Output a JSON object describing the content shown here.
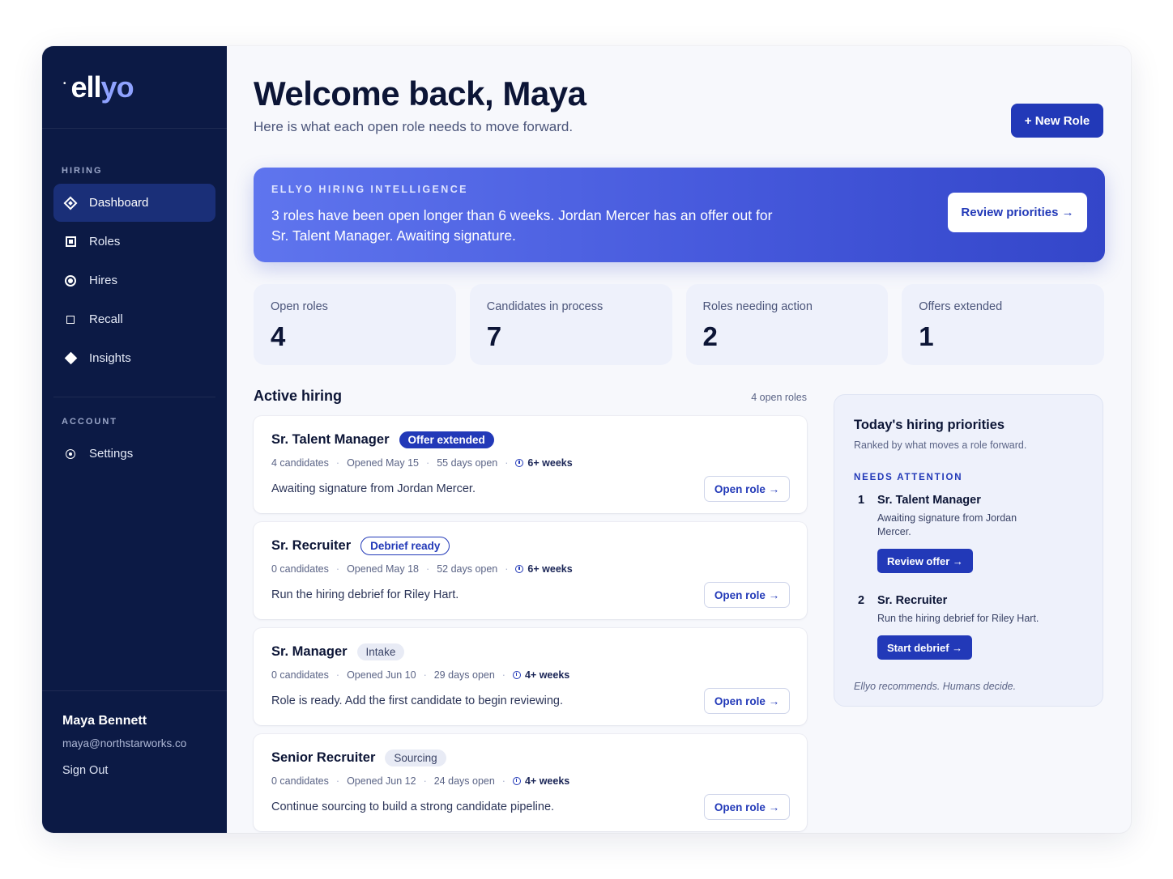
{
  "brand": {
    "name_main": "ell",
    "name_accent": "yo"
  },
  "sidebar": {
    "hiring_title": "HIRING",
    "items": [
      {
        "label": "Dashboard",
        "icon": "diamond-icon",
        "active": true
      },
      {
        "label": "Roles",
        "icon": "square-icon"
      },
      {
        "label": "Hires",
        "icon": "circle-icon"
      },
      {
        "label": "Recall",
        "icon": "square-outline-icon"
      },
      {
        "label": "Insights",
        "icon": "diamond-filled-icon"
      }
    ],
    "account_title": "ACCOUNT",
    "account_items": [
      {
        "label": "Settings",
        "icon": "gear-icon"
      }
    ],
    "user": {
      "name": "Maya Bennett",
      "email": "maya@northstarworks.co",
      "sign_out": "Sign Out"
    }
  },
  "header": {
    "title": "Welcome back, Maya",
    "subtitle": "Here is what each open role needs to move forward.",
    "new_role": "+ New Role"
  },
  "hero": {
    "label": "ELLYO HIRING INTELLIGENCE",
    "text": "3 roles have been open longer than 6 weeks. Jordan Mercer has an offer out for Sr. Talent Manager. Awaiting signature.",
    "button": "Review priorities →"
  },
  "stats": [
    {
      "label": "Open roles",
      "value": "4"
    },
    {
      "label": "Candidates in process",
      "value": "7"
    },
    {
      "label": "Roles needing action",
      "value": "2"
    },
    {
      "label": "Offers extended",
      "value": "1"
    }
  ],
  "active": {
    "title": "Active hiring",
    "count": "4 open roles",
    "open_label": "Open role →",
    "roles": [
      {
        "title": "Sr. Talent Manager",
        "badge": "Offer extended",
        "badge_style": "solid",
        "candidates": "4 candidates",
        "opened": "Opened May 15",
        "days": "55 days open",
        "age": "6+ weeks",
        "desc": "Awaiting signature from Jordan Mercer."
      },
      {
        "title": "Sr. Recruiter",
        "badge": "Debrief ready",
        "badge_style": "outline",
        "candidates": "0 candidates",
        "opened": "Opened May 18",
        "days": "52 days open",
        "age": "6+ weeks",
        "desc": "Run the hiring debrief for Riley Hart."
      },
      {
        "title": "Sr. Manager",
        "badge": "Intake",
        "badge_style": "soft",
        "candidates": "0 candidates",
        "opened": "Opened Jun 10",
        "days": "29 days open",
        "age": "4+ weeks",
        "desc": "Role is ready. Add the first candidate to begin reviewing."
      },
      {
        "title": "Senior Recruiter",
        "badge": "Sourcing",
        "badge_style": "soft",
        "candidates": "0 candidates",
        "opened": "Opened Jun 12",
        "days": "24 days open",
        "age": "4+ weeks",
        "desc": "Continue sourcing to build a strong candidate pipeline."
      }
    ]
  },
  "priorities": {
    "title": "Today's hiring priorities",
    "subtitle": "Ranked by what moves a role forward.",
    "label": "NEEDS ATTENTION",
    "items": [
      {
        "num": "1",
        "role": "Sr. Talent Manager",
        "text": "Awaiting signature from Jordan Mercer.",
        "button": "Review offer →"
      },
      {
        "num": "2",
        "role": "Sr. Recruiter",
        "text": "Run the hiring debrief for Riley Hart.",
        "button": "Start debrief →"
      }
    ],
    "footer": "Ellyo recommends. Humans decide."
  },
  "colors": {
    "sidebar": "#0c1a45",
    "accent": "#2239b8",
    "hero_start": "#5f75ee",
    "hero_end": "#3346c9"
  }
}
